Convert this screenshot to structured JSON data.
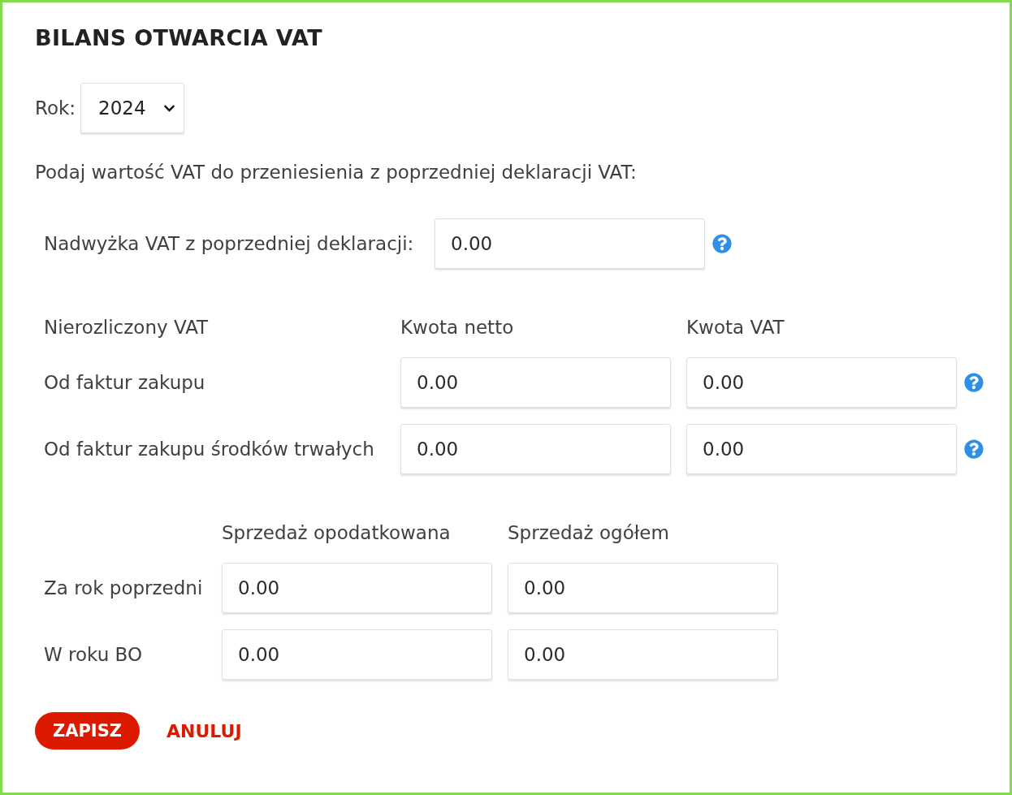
{
  "title": "BILANS OTWARCIA VAT",
  "year": {
    "label": "Rok:",
    "value": "2024"
  },
  "instruction": "Podaj wartość VAT do przeniesienia z poprzedniej deklaracji VAT:",
  "surplus": {
    "label": "Nadwyżka VAT z poprzedniej deklaracji:",
    "value": "0.00"
  },
  "unsettled": {
    "columns": [
      "Nierozliczony VAT",
      "Kwota netto",
      "Kwota VAT"
    ],
    "rows": [
      {
        "label": "Od faktur zakupu",
        "net": "0.00",
        "vat": "0.00"
      },
      {
        "label": "Od faktur zakupu środków trwałych",
        "net": "0.00",
        "vat": "0.00"
      }
    ]
  },
  "sales": {
    "columns": [
      "Sprzedaż opodatkowana",
      "Sprzedaż ogółem"
    ],
    "rows": [
      {
        "label": "Za rok poprzedni",
        "taxed": "0.00",
        "total": "0.00"
      },
      {
        "label": "W roku BO",
        "taxed": "0.00",
        "total": "0.00"
      }
    ]
  },
  "buttons": [
    {
      "label": "ZAPISZ",
      "kind": "primary"
    },
    {
      "label": "ANULUJ",
      "kind": "link"
    }
  ]
}
